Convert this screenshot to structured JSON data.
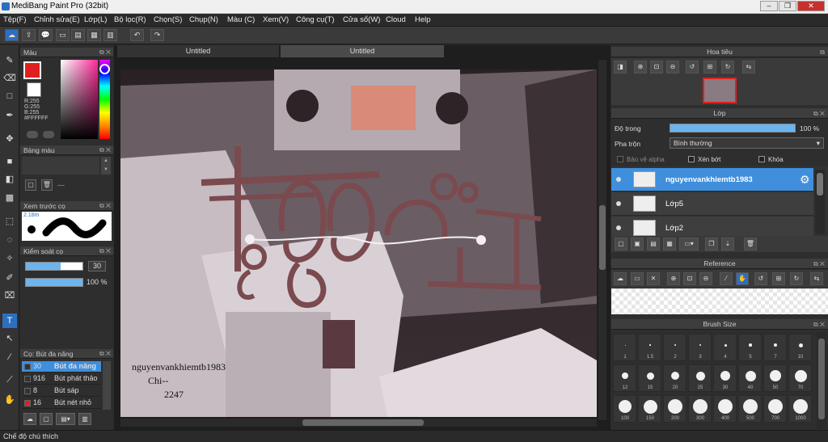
{
  "window": {
    "title": "MediBang Paint Pro (32bit)"
  },
  "menu": [
    "Tệp(F)",
    "Chỉnh sửa(E)",
    "Lớp(L)",
    "Bộ lọc(R)",
    "Chọn(S)",
    "Chụp(N)",
    "Màu (C)",
    "Xem(V)",
    "Công cụ(T)",
    "Cửa sổ(W)",
    "Cloud",
    "Help"
  ],
  "tabs": {
    "doc1": "Untitled",
    "doc2": "Untitled"
  },
  "color_panel": {
    "title": "Màu",
    "r": "R:255",
    "g": "G:255",
    "b": "B:255",
    "hex": "#FFFFFF"
  },
  "palette_panel": {
    "title": "Bảng màu",
    "dash": "---"
  },
  "preview_panel": {
    "title": "Xem trước cọ",
    "size": "2.18m"
  },
  "brush_control": {
    "title": "Kiểm soát cọ",
    "size": "30",
    "opacity": "100 %",
    "size_fill": 0.62,
    "opacity_fill": 1.0
  },
  "brush_panel": {
    "title": "Cọ: Bút đa năng",
    "items": [
      {
        "num": "30",
        "label": "Bút đa năng",
        "selected": true
      },
      {
        "num": "916",
        "label": "Bút phát thảo"
      },
      {
        "num": "8",
        "label": "Bút sáp"
      },
      {
        "num": "16",
        "label": "Bút nét nhỏ"
      }
    ]
  },
  "canvas_text": {
    "line1": "nguyenvankhiemtb1983",
    "line2": "Chi--",
    "line3": "2247"
  },
  "navigator": {
    "title": "Hoa tiêu"
  },
  "layer_panel": {
    "title": "Lớp",
    "opacity_label": "Độ trong",
    "opacity_value": "100 %",
    "blend_label": "Pha trộn",
    "blend_value": "Bình thường",
    "protect_alpha": "Bảo vệ alpha",
    "clipping": "Xén bớt",
    "lock": "Khóa",
    "layers": [
      {
        "name": "nguyenvankhiemtb1983",
        "selected": true
      },
      {
        "name": "Lớp5"
      },
      {
        "name": "Lớp2"
      }
    ]
  },
  "reference_panel": {
    "title": "Reference"
  },
  "brush_size_panel": {
    "title": "Brush Size",
    "sizes": [
      "1",
      "1.5",
      "2",
      "3",
      "4",
      "5",
      "7",
      "10",
      "12",
      "15",
      "20",
      "25",
      "30",
      "40",
      "50",
      "70",
      "100",
      "150",
      "200",
      "300",
      "400",
      "500",
      "700",
      "1000"
    ]
  },
  "status": {
    "text": "Chế độ chú thích"
  },
  "colors": {
    "accent": "#3f8fdc",
    "primary_red": "#e02020",
    "art_brown": "#7a4a4e"
  }
}
